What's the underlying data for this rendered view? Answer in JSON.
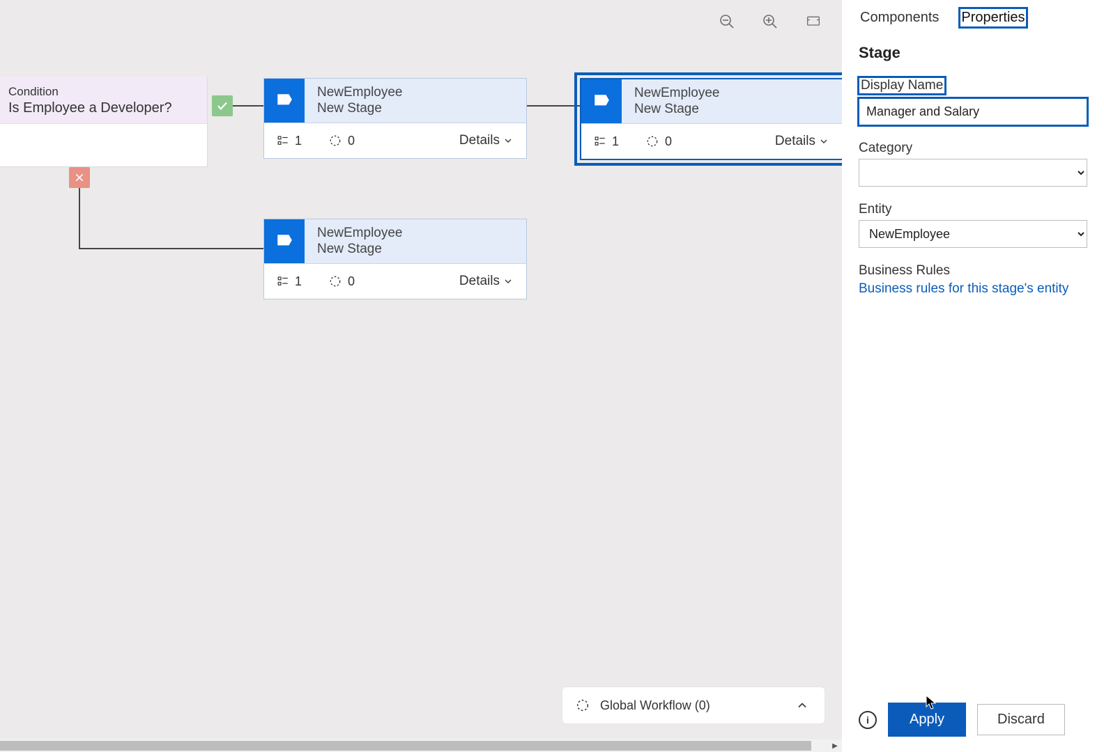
{
  "tabs": {
    "components": "Components",
    "properties": "Properties"
  },
  "panel": {
    "section_title": "Stage",
    "display_name_label": "Display Name",
    "display_name_value": "Manager and Salary",
    "category_label": "Category",
    "category_value": "",
    "entity_label": "Entity",
    "entity_value": "NewEmployee",
    "business_rules_label": "Business Rules",
    "business_rules_link": "Business rules for this stage's entity",
    "apply_label": "Apply",
    "discard_label": "Discard"
  },
  "condition": {
    "caption": "Condition",
    "title": "Is Employee a Developer?"
  },
  "stages": [
    {
      "entity": "NewEmployee",
      "name": "New Stage",
      "steps": "1",
      "workflows": "0",
      "details": "Details"
    },
    {
      "entity": "NewEmployee",
      "name": "New Stage",
      "steps": "1",
      "workflows": "0",
      "details": "Details"
    },
    {
      "entity": "NewEmployee",
      "name": "New Stage",
      "steps": "1",
      "workflows": "0",
      "details": "Details"
    }
  ],
  "global_workflow": {
    "label": "Global Workflow (0)"
  }
}
